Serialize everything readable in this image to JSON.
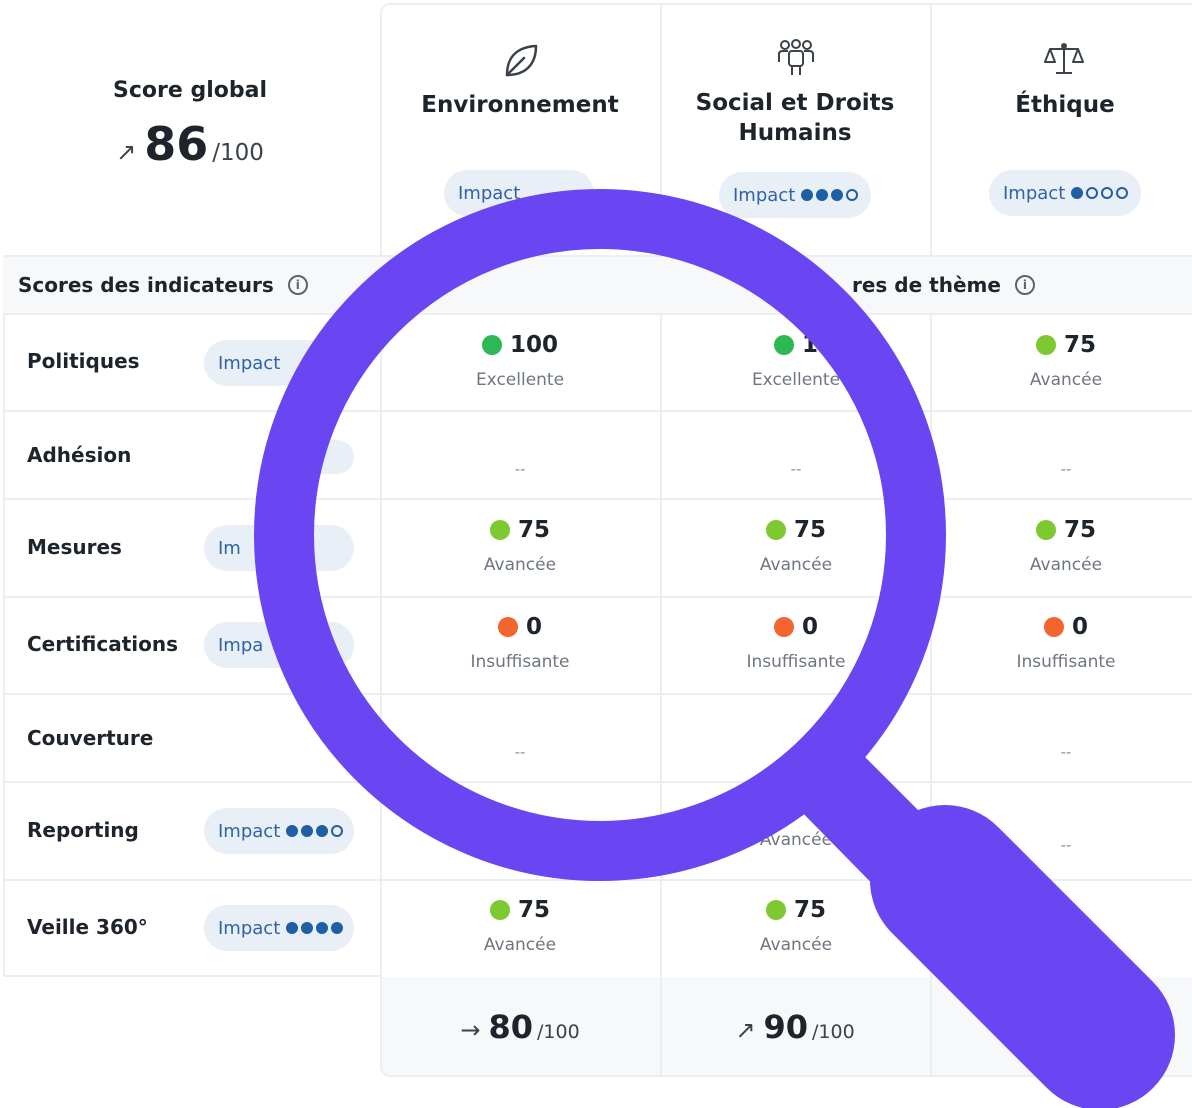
{
  "global": {
    "title": "Score global",
    "value": "86",
    "max": "/100",
    "trend_icon": "arrow-up-right-icon"
  },
  "columns": [
    {
      "title": "Environnement",
      "icon": "leaf-icon",
      "impact_label": "Impact",
      "impact_level": 2,
      "total": "80",
      "total_max": "/100",
      "trend_icon": "arrow-right-icon"
    },
    {
      "title_line1": "Social et Droits",
      "title_line2": "Humains",
      "icon": "people-icon",
      "impact_label": "Impact",
      "impact_level": 3,
      "total": "90",
      "total_max": "/100",
      "trend_icon": "arrow-up-right-icon"
    },
    {
      "title": "Éthique",
      "icon": "scales-icon",
      "impact_label": "Impact",
      "impact_level": 1
    }
  ],
  "sections": {
    "indicators": "Scores des indicateurs",
    "theme_fragment": "res de thème"
  },
  "rows": [
    {
      "label": "Politiques",
      "impact_label": "Impact",
      "cells": [
        {
          "score": "100",
          "level": "Excellente",
          "color": "#2db755"
        },
        {
          "score": "1",
          "level": "Excellente",
          "color": "#2db755"
        },
        {
          "score": "75",
          "level": "Avancée",
          "color": "#7ec832"
        }
      ]
    },
    {
      "label": "Adhésion",
      "cells": [
        {
          "dash": "--"
        },
        {
          "dash": "--"
        },
        {
          "dash": "--"
        }
      ]
    },
    {
      "label": "Mesures",
      "impact_label": "Im",
      "cells": [
        {
          "score": "75",
          "level": "Avancée",
          "color": "#7ec832"
        },
        {
          "score": "75",
          "level": "Avancée",
          "color": "#7ec832"
        },
        {
          "score": "75",
          "level": "Avancée",
          "color": "#7ec832"
        }
      ]
    },
    {
      "label": "Certifications",
      "impact_label": "Impa",
      "cells": [
        {
          "score": "0",
          "level": "Insuffisante",
          "color": "#f2652f"
        },
        {
          "score": "0",
          "level": "Insuffisante",
          "color": "#f2652f"
        },
        {
          "score": "0",
          "level": "Insuffisante",
          "color": "#f2652f"
        }
      ]
    },
    {
      "label": "Couverture",
      "cells": [
        {
          "dash": "--"
        },
        {
          "dash": "--"
        }
      ]
    },
    {
      "label": "Reporting",
      "impact_label": "Impact",
      "impact_level": 3,
      "cells": [
        {
          "level": "Avancée"
        },
        {
          "dash": "--"
        }
      ]
    },
    {
      "label": "Veille 360°",
      "impact_label": "Impact",
      "impact_level": 4,
      "cells": [
        {
          "score": "75",
          "level": "Avancée",
          "color": "#7ec832"
        },
        {
          "score": "75",
          "level": "Avancée",
          "color": "#7ec832"
        }
      ]
    }
  ],
  "overlay": {
    "icon": "magnifying-glass-icon",
    "color": "#6a45f2"
  }
}
